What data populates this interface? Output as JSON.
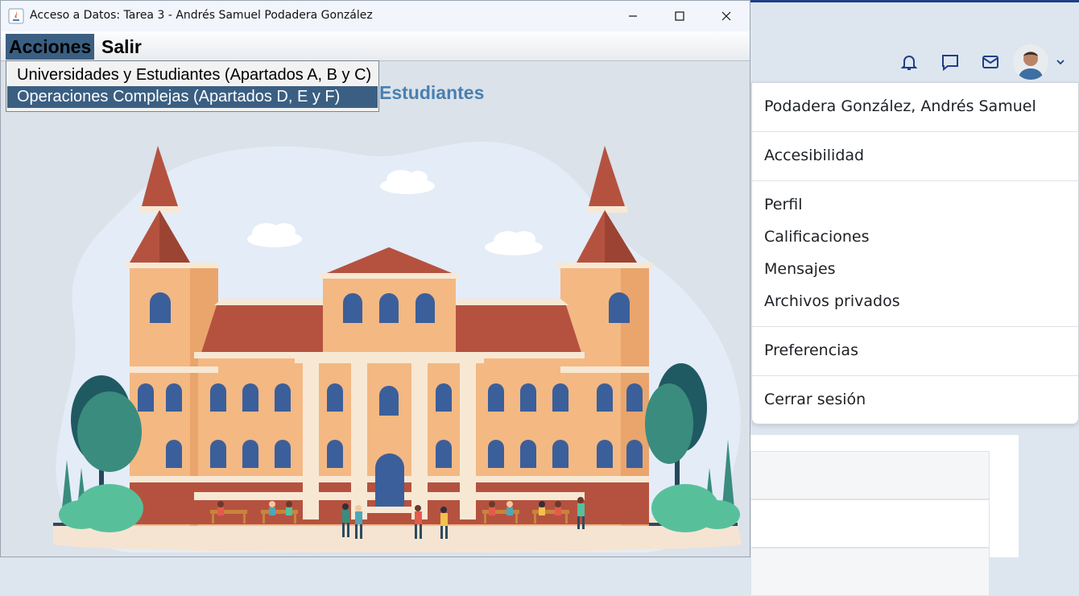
{
  "java_window": {
    "title": "Acceso a Datos: Tarea 3 - Andrés Samuel Podadera González",
    "menus": [
      {
        "label": "Acciones"
      },
      {
        "label": "Salir"
      }
    ],
    "popup_items": [
      {
        "label": "Universidades y Estudiantes (Apartados A, B y C)"
      },
      {
        "label": "Operaciones Complejas (Apartados D, E y F)"
      }
    ],
    "heading_fragment": "Estudiantes",
    "illustration": "university-building-illustration"
  },
  "browser_header": {
    "icons": [
      "bell-icon",
      "chat-icon",
      "mail-icon"
    ]
  },
  "user_menu": {
    "name": "Podadera González, Andrés Samuel",
    "items": [
      {
        "label": "Accesibilidad"
      },
      {
        "label": "Perfil"
      },
      {
        "label": "Calificaciones"
      },
      {
        "label": "Mensajes"
      },
      {
        "label": "Archivos privados"
      },
      {
        "label": "Preferencias"
      },
      {
        "label": "Cerrar sesión"
      }
    ]
  },
  "colors": {
    "menu_highlight": "#3b5f82",
    "heading": "#4a7fb0",
    "brick": "#b5523f",
    "wall": "#f4b883"
  }
}
